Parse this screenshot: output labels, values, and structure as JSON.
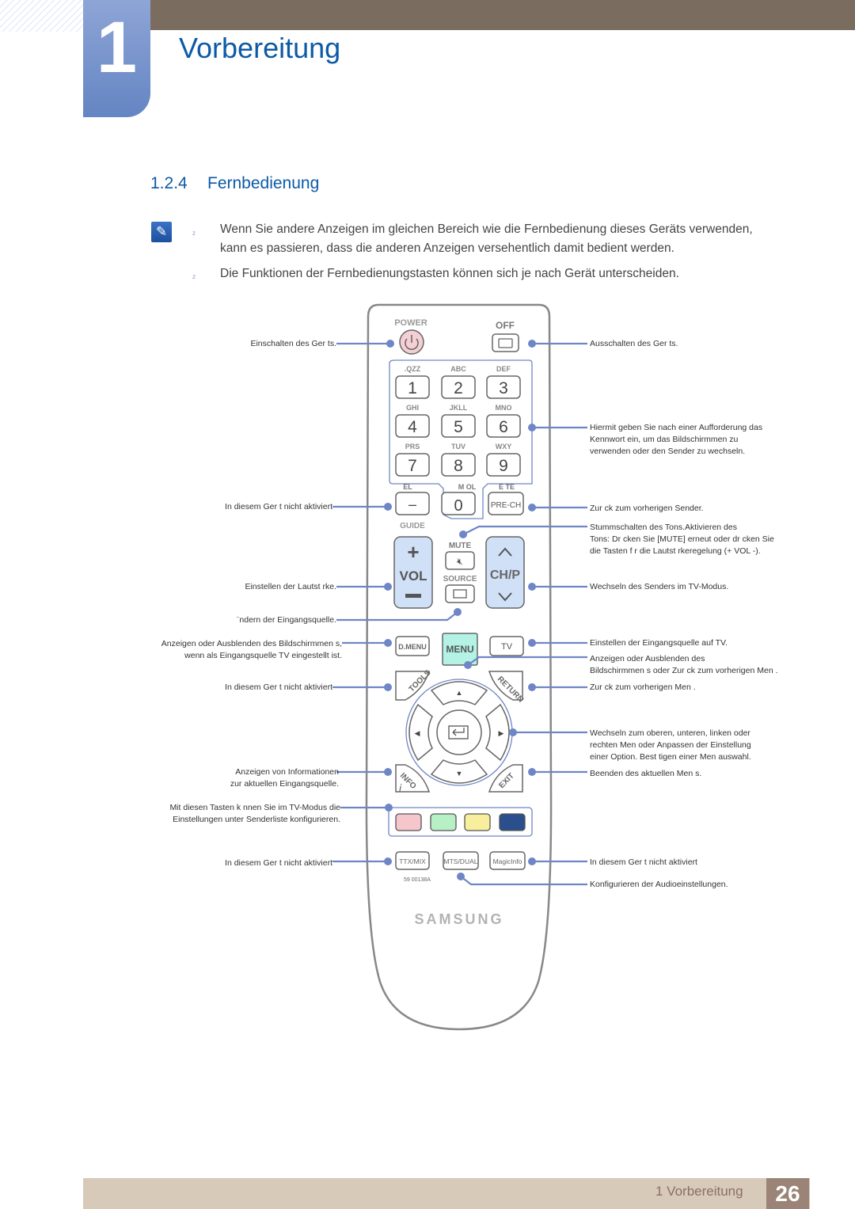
{
  "header": {
    "chapter_number": "1",
    "chapter_title": "Vorbereitung"
  },
  "section": {
    "number": "1.2.4",
    "title": "Fernbedienung"
  },
  "notes": {
    "icon": "note-pencil-icon",
    "bullet_glyph": "z",
    "items": [
      {
        "line1": "Wenn Sie andere Anzeigen im gleichen Bereich wie die Fernbedienung dieses Geräts verwenden,",
        "line2": "kann es passieren, dass die anderen Anzeigen versehentlich damit bedient werden."
      },
      {
        "line1": "Die Funktionen der Fernbedienungstasten können sich je nach Gerät unterscheiden."
      }
    ]
  },
  "remote": {
    "colors": {
      "callout": "#6f86c6",
      "body_outline": "#888888",
      "power_button": "#f4cfd3",
      "vol_ch_fill": "#cfe0f7",
      "menu_fill": "#b3f2e4",
      "red": "#f6c6cd",
      "green": "#b7f0c4",
      "yellow": "#f7ef9e",
      "blue": "#2a4f8c",
      "brand": "#b3b3b3"
    },
    "buttons": {
      "power_label": "POWER",
      "off_label": "OFF",
      "keypad": [
        {
          "digit": "1",
          "letters": ".QZZ"
        },
        {
          "digit": "2",
          "letters": "ABC"
        },
        {
          "digit": "3",
          "letters": "DEF"
        },
        {
          "digit": "4",
          "letters": "GHI"
        },
        {
          "digit": "5",
          "letters": "JKLL"
        },
        {
          "digit": "6",
          "letters": "MNO"
        },
        {
          "digit": "7",
          "letters": "PRS"
        },
        {
          "digit": "8",
          "letters": "TUV"
        },
        {
          "digit": "9",
          "letters": "WXY"
        }
      ],
      "dash": "–",
      "zero": "0",
      "prech": "PRE-CH",
      "row_labels": {
        "del": "EL",
        "symbol": "M OL",
        "delete": "E TE"
      },
      "guide": "GUIDE",
      "vol": "VOL",
      "vol_plus": "+",
      "vol_minus": "–",
      "mute": "MUTE",
      "source": "SOURCE",
      "ch": "CH/P",
      "dmenu": "D.MENU",
      "menu": "MENU",
      "tv": "TV",
      "tools": "TOOLS",
      "return": "RETURN",
      "info": "INFO",
      "exit": "EXIT",
      "ttx": "TTX/MIX",
      "mts": "MTS/DUAL",
      "magicinfo": "MagicInfo",
      "model_code": "59 00138A",
      "brand": "SAMSUNG"
    },
    "callouts_left": [
      {
        "text": "Einschalten des Ger ts."
      },
      {
        "text": "In diesem Ger t nicht aktiviert"
      },
      {
        "text": "Einstellen der Lautst rke."
      },
      {
        "text": "¨ndern der Eingangsquelle."
      },
      {
        "line1": "Anzeigen oder Ausblenden des Bildschirmmen s,",
        "line2": "wenn als Eingangsquelle TV eingestellt ist."
      },
      {
        "text": "In diesem Ger t nicht aktiviert"
      },
      {
        "line1": "Anzeigen von Informationen",
        "line2": "zur aktuellen Eingangsquelle."
      },
      {
        "line1": "Mit diesen Tasten k nnen Sie im TV-Modus die",
        "line2": "Einstellungen unter Senderliste konfigurieren."
      },
      {
        "text": "In diesem Ger t nicht aktiviert"
      }
    ],
    "callouts_right": [
      {
        "text": "Ausschalten des Ger ts."
      },
      {
        "line1": "Hiermit geben Sie nach einer Aufforderung das",
        "line2": "Kennwort ein, um das Bildschirmmen  zu",
        "line3": "verwenden oder den Sender zu wechseln."
      },
      {
        "text": "Zur ck zum vorherigen Sender."
      },
      {
        "line1": "Stummschalten des Tons.Aktivieren des",
        "line2": "Tons: Dr cken Sie [MUTE] erneut oder dr cken Sie",
        "line3": "die Tasten f r die Lautst rkeregelung (+ VOL -)."
      },
      {
        "text": "Wechseln des Senders im TV-Modus."
      },
      {
        "text": "Einstellen der Eingangsquelle auf TV."
      },
      {
        "line1": "Anzeigen oder Ausblenden des",
        "line2": "Bildschirmmen s oder Zur ck zum vorherigen Men ."
      },
      {
        "text": "Zur ck zum vorherigen Men ."
      },
      {
        "line1": "Wechseln zum oberen, unteren, linken oder",
        "line2": "rechten Men  oder Anpassen der Einstellung",
        "line3": "einer Option. Best tigen einer Men auswahl."
      },
      {
        "text": "Beenden des aktuellen Men s."
      },
      {
        "text": "In diesem Ger t nicht aktiviert"
      },
      {
        "text": "Konfigurieren der Audioeinstellungen."
      }
    ]
  },
  "footer": {
    "chapter_label": "1 Vorbereitung",
    "page_number": "26"
  }
}
